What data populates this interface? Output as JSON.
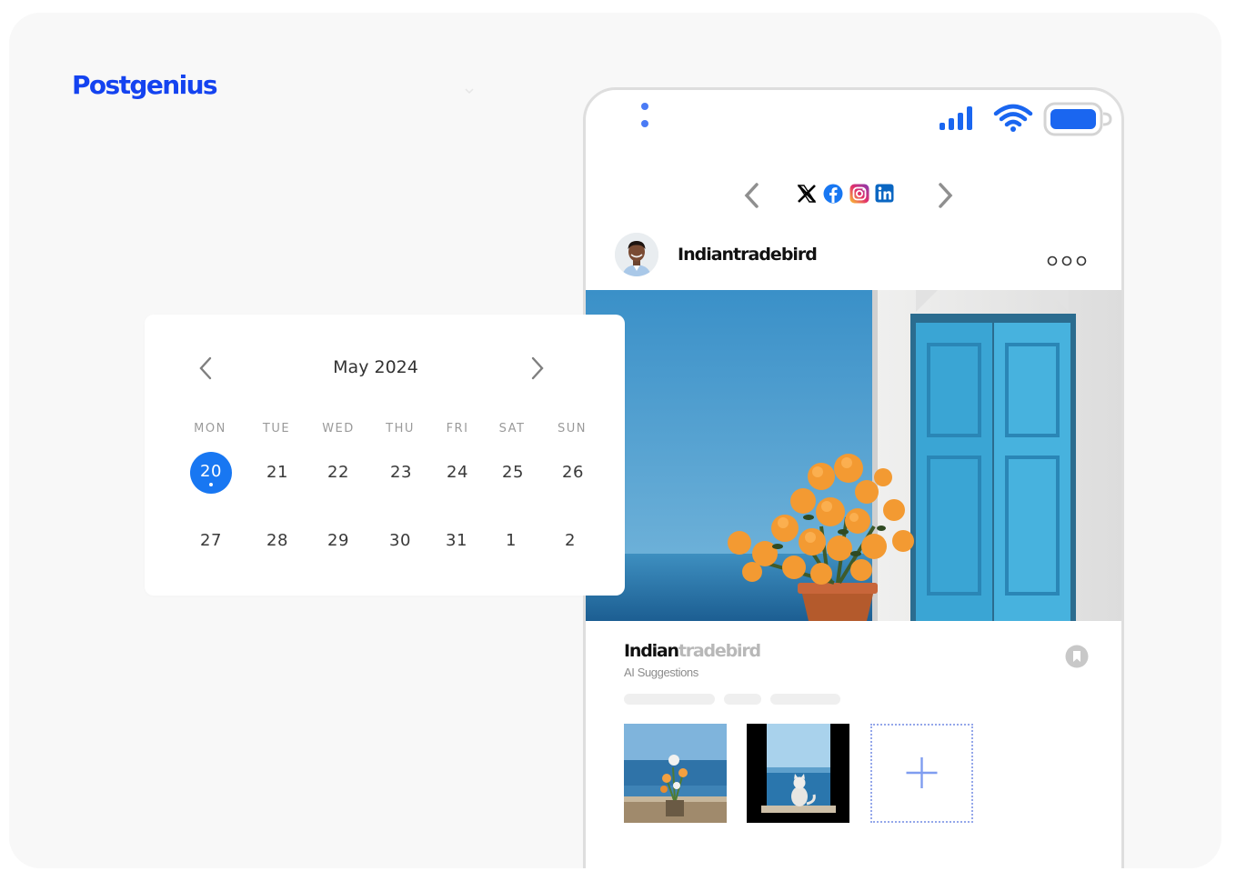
{
  "brand": {
    "name": "Postgenius"
  },
  "phone": {
    "social_networks": [
      {
        "name": "X",
        "icon": "x-icon",
        "color": "#000000"
      },
      {
        "name": "Facebook",
        "icon": "facebook-icon",
        "color": "#1877f2"
      },
      {
        "name": "Instagram",
        "icon": "instagram-icon",
        "color": "#d6249f"
      },
      {
        "name": "LinkedIn",
        "icon": "linkedin-icon",
        "color": "#0a66c2"
      }
    ],
    "profile": {
      "username": "Indiantradebird"
    },
    "post": {
      "username_part1": "Indian",
      "username_part2": "tradebird",
      "ai_suggestions_label": "AI Suggestions"
    },
    "add_tile_label": "+"
  },
  "calendar": {
    "title": "May 2024",
    "weekdays": [
      "MON",
      "TUE",
      "WED",
      "THU",
      "FRI",
      "SAT",
      "SUN"
    ],
    "weeks": [
      [
        "20",
        "21",
        "22",
        "23",
        "24",
        "25",
        "26"
      ],
      [
        "27",
        "28",
        "29",
        "30",
        "31",
        "1",
        "2"
      ]
    ],
    "selected_day": "20"
  },
  "colors": {
    "brand": "#1443f0",
    "accent": "#1877f2",
    "status_icons": "#1a66f0"
  }
}
